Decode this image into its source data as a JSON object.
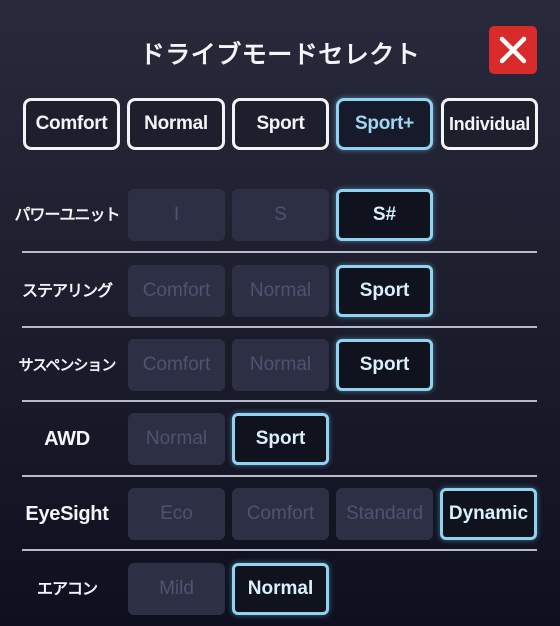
{
  "header": {
    "title": "ドライブモードセレクト",
    "close_icon": "close-x-icon"
  },
  "colors": {
    "close_button": "#d92b2b",
    "active_accent": "#8fd3f0",
    "inactive_option_bg": "#2d3045",
    "inactive_option_text": "#4d5370"
  },
  "modes": {
    "selected": "Sport+",
    "items": [
      {
        "label": "Comfort",
        "active": false
      },
      {
        "label": "Normal",
        "active": false
      },
      {
        "label": "Sport",
        "active": false
      },
      {
        "label": "Sport+",
        "active": true
      },
      {
        "label": "Individual",
        "active": false
      }
    ]
  },
  "settings": [
    {
      "label": "パワーユニット",
      "options": [
        "I",
        "S",
        "S#"
      ],
      "selected": "S#"
    },
    {
      "label": "ステアリング",
      "options": [
        "Comfort",
        "Normal",
        "Sport"
      ],
      "selected": "Sport"
    },
    {
      "label": "サスペンション",
      "options": [
        "Comfort",
        "Normal",
        "Sport"
      ],
      "selected": "Sport"
    },
    {
      "label": "AWD",
      "options": [
        "Normal",
        "Sport"
      ],
      "selected": "Sport"
    },
    {
      "label": "EyeSight",
      "options": [
        "Eco",
        "Comfort",
        "Standard",
        "Dynamic"
      ],
      "selected": "Dynamic"
    },
    {
      "label": "エアコン",
      "options": [
        "Mild",
        "Normal"
      ],
      "selected": "Normal"
    }
  ]
}
